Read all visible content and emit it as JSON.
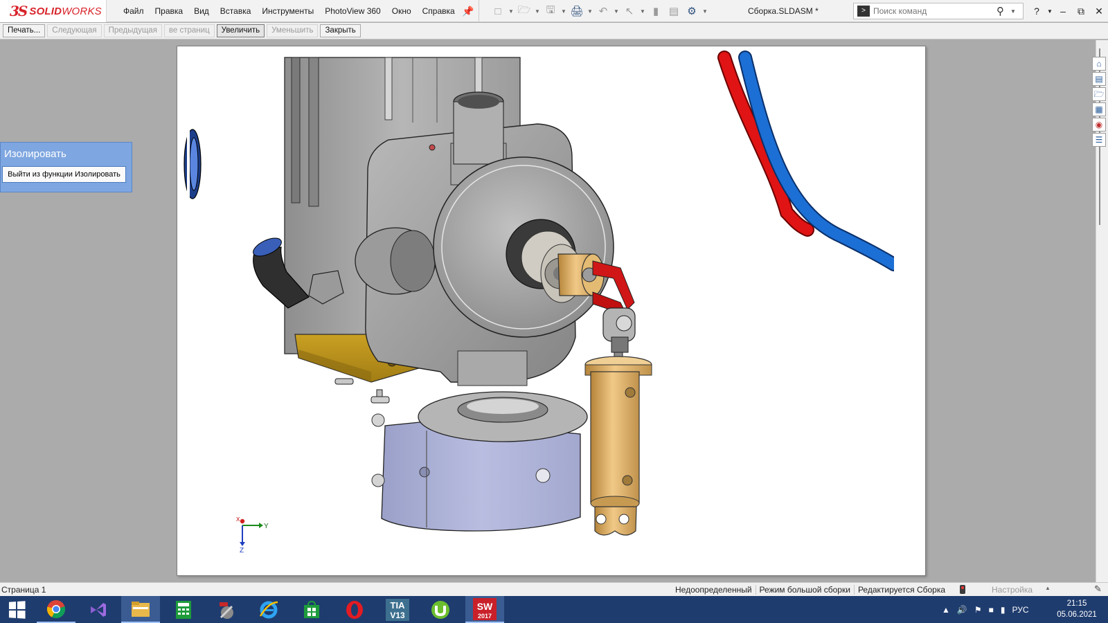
{
  "app": {
    "logo_prefix": "3S",
    "logo_bold": "SOLID",
    "logo_light": "WORKS",
    "document_title": "Сборка.SLDASM *"
  },
  "menu": {
    "items": [
      "Файл",
      "Правка",
      "Вид",
      "Вставка",
      "Инструменты",
      "PhotoView 360",
      "Окно",
      "Справка"
    ]
  },
  "quick_tools": [
    "new-document-icon",
    "open-icon",
    "save-icon",
    "print-icon",
    "undo-icon",
    "select-icon",
    "rebuild-icon",
    "file-properties-icon",
    "options-icon"
  ],
  "search": {
    "placeholder": "Поиск команд"
  },
  "print_preview": {
    "buttons": {
      "print": "Печать...",
      "next": "Следующая",
      "prev": "Предыдущая",
      "two_pages": "ве страниц",
      "zoom_in": "Увеличить",
      "zoom_out": "Уменьшить",
      "close": "Закрыть"
    }
  },
  "isolate": {
    "title": "Изолировать",
    "exit_label": "Выйти из функции Изолировать"
  },
  "triad": {
    "x": "X",
    "y": "Y",
    "z": "Z"
  },
  "statusbar": {
    "page": "Страница 1",
    "definition": "Недоопределенный",
    "large_assembly": "Режим большой сборки",
    "editing": "Редактируется Сборка",
    "customize": "Настройка"
  },
  "taskbar": {
    "apps": [
      "chrome",
      "visual-studio",
      "file-explorer",
      "calculator",
      "sc-tool",
      "internet-explorer",
      "store",
      "opera",
      "tia-portal",
      "utorrent",
      "solidworks-2017"
    ],
    "tia_label": "TIA",
    "tia_version": "V13",
    "sw_version": "2017",
    "language": "РУС",
    "time": "21:15",
    "date": "05.06.2021"
  },
  "colors": {
    "brand_red": "#d8232a",
    "isolate_blue": "#7ea6e0",
    "taskbar": "#1f3c6e",
    "hose_red": "#e01414",
    "hose_blue": "#1c6fd4",
    "brass": "#e8b868"
  }
}
